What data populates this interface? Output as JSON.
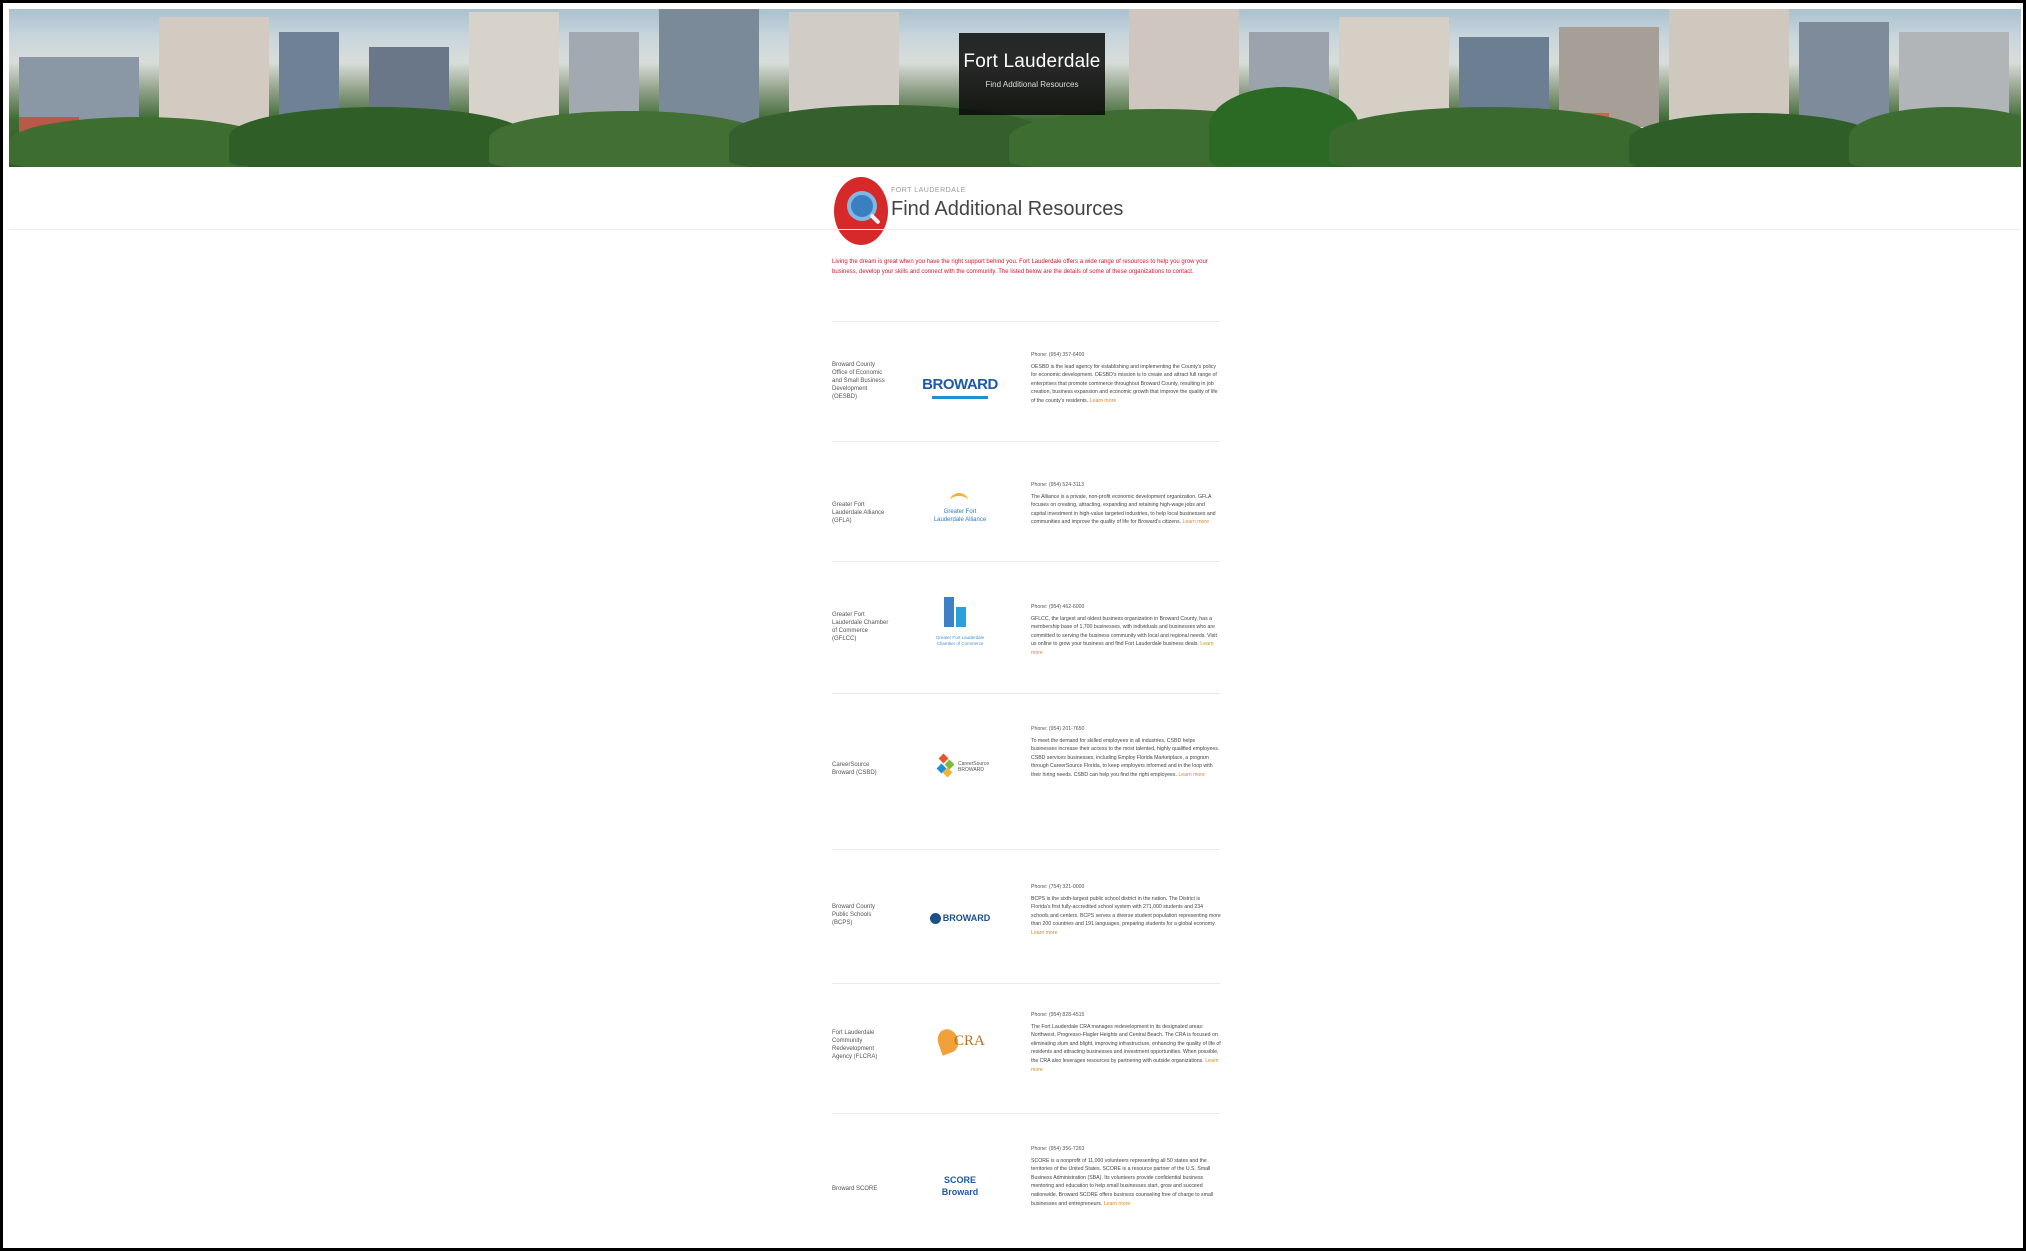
{
  "hero": {
    "title": "Fort Lauderdale",
    "subtitle": "Find Additional Resources"
  },
  "section": {
    "kicker": "FORT LAUDERDALE",
    "title": "Find Additional Resources",
    "icon": "magnifier-icon",
    "intro": "Living the dream is great when you have the right support behind you. Fort Lauderdale offers a wide range of resources to help you grow your business, develop your skills and connect with the community. The listed below are the details of some of these organizations to contact."
  },
  "colors": {
    "accent": "#d62a2a",
    "intro_text": "#c8192b",
    "learn_more": "#d08a2a"
  },
  "resources": [
    {
      "name": "Broward County Office of Economic and Small Business Development (OESBD)",
      "logo": "broward-logo",
      "logo_text": "BROWARD",
      "phone": "Phone: (954) 357-6400",
      "description": "OESBD is the lead agency for establishing and implementing the County's policy for economic development. OESBD's mission is to create and attract full range of enterprises that promote commerce throughout Broward County, resulting in job creation, business expansion and economic growth that improve the quality of life of the county's residents.",
      "more": "Learn more"
    },
    {
      "name": "Greater Fort Lauderdale Alliance (GFLA)",
      "logo": "gfla-logo",
      "logo_text": "Greater Fort Lauderdale Alliance",
      "phone": "Phone: (954) 524-3113",
      "description": "The Alliance is a private, non-profit economic development organization. GFLA focuses on creating, attracting, expanding and retaining high-wage jobs and capital investment in high-value targeted industries, to help local businesses and communities and improve the quality of life for Broward's citizens.",
      "more": "Learn more"
    },
    {
      "name": "Greater Fort Lauderdale Chamber of Commerce (GFLCC)",
      "logo": "gflcc-logo",
      "logo_text": "Greater Fort Lauderdale Chamber of Commerce",
      "phone": "Phone: (954) 462-6000",
      "description": "GFLCC, the largest and oldest business organization in Broward County, has a membership base of 1,700 businesses, with individuals and businesses who are committed to serving the business community with local and regional needs. Visit us online to grow your business and find Fort Lauderdale business deals.",
      "more": "Learn more"
    },
    {
      "name": "CareerSource Broward (CSBD)",
      "logo": "careersource-logo",
      "logo_text": "CareerSource BROWARD",
      "phone": "Phone: (954) 201-7650",
      "description": "To meet the demand for skilled employees in all industries, CSBD helps businesses increase their access to the most talented, highly qualified employees. CSBD services businesses, including Employ Florida Marketplace, a program through CareerSource Florida, to keep employers informed and in the loop with their hiring needs. CSBD can help you find the right employees.",
      "more": "Learn more"
    },
    {
      "name": "Broward County Public Schools (BCPS)",
      "logo": "bcps-logo",
      "logo_text": "BROWARD",
      "phone": "Phone: (754) 321-0000",
      "description": "BCPS is the sixth-largest public school district in the nation. The District is Florida's first fully-accredited school system with 271,000 students and 234 schools and centers. BCPS serves a diverse student population representing more than 200 countries and 191 languages, preparing students for a global economy.",
      "more": "Learn more"
    },
    {
      "name": "Fort Lauderdale Community Redevelopment Agency (FLCRA)",
      "logo": "cra-logo",
      "logo_text": "CRA",
      "phone": "Phone: (954) 828-4515",
      "description": "The Fort Lauderdale CRA manages redevelopment in its designated areas: Northwest, Progresso-Flagler Heights and Central Beach. The CRA is focused on eliminating slum and blight, improving infrastructure, enhancing the quality of life of residents and attracting businesses and investment opportunities. When possible, the CRA also leverages resources by partnering with outside organizations.",
      "more": "Learn more"
    },
    {
      "name": "Broward SCORE",
      "logo": "score-logo",
      "logo_text": "SCORE Broward",
      "phone": "Phone: (954) 356-7263",
      "description": "SCORE is a nonprofit of 11,000 volunteers representing all 50 states and the territories of the United States. SCORE is a resource partner of the U.S. Small Business Administration (SBA). Its volunteers provide confidential business mentoring and education to help small businesses start, grow and succeed nationwide. Broward SCORE offers business counseling free of charge to small businesses and entrepreneurs.",
      "more": "Learn more"
    }
  ]
}
